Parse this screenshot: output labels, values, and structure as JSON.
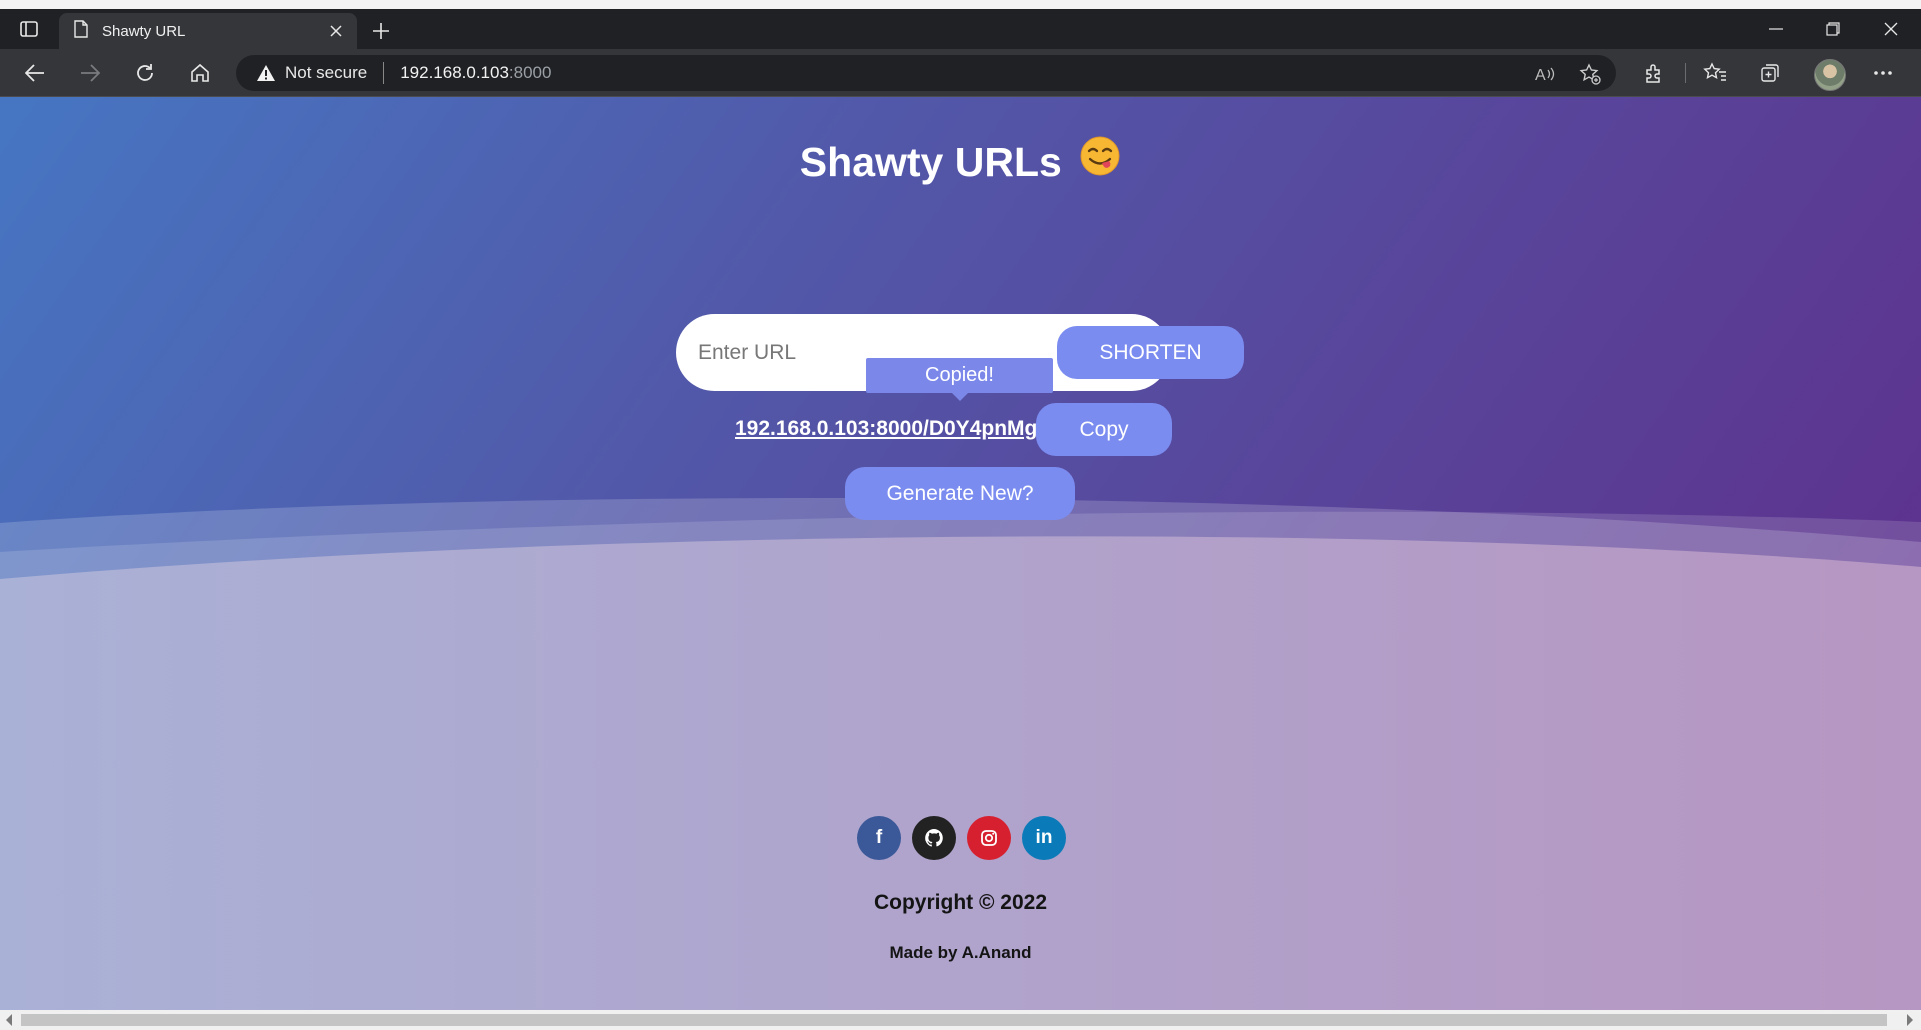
{
  "browser": {
    "tab_title": "Shawty URL",
    "address_warning": "Not secure",
    "address_host": "192.168.0.103",
    "address_port": ":8000"
  },
  "page": {
    "title": "Shawty URLs",
    "title_emoji": "😋",
    "input_placeholder": "Enter URL",
    "input_value": "",
    "shorten_label": "SHORTEN",
    "tooltip": "Copied!",
    "short_url": "192.168.0.103:8000/D0Y4pnMg",
    "copy_label": "Copy",
    "generate_label": "Generate New?",
    "social": [
      {
        "name": "facebook",
        "glyph": "f",
        "color": "#3b5998"
      },
      {
        "name": "github",
        "glyph": "",
        "color": "#222222"
      },
      {
        "name": "instagram",
        "glyph": "",
        "color": "#d6202f"
      },
      {
        "name": "linkedin",
        "glyph": "in",
        "color": "#0a7ab8"
      }
    ],
    "copyright": "Copyright © 2022",
    "made_by": "Made by A.Anand"
  },
  "colors": {
    "button": "#7b8cf0",
    "chrome_dark": "#202124",
    "chrome_tab": "#35363a"
  }
}
